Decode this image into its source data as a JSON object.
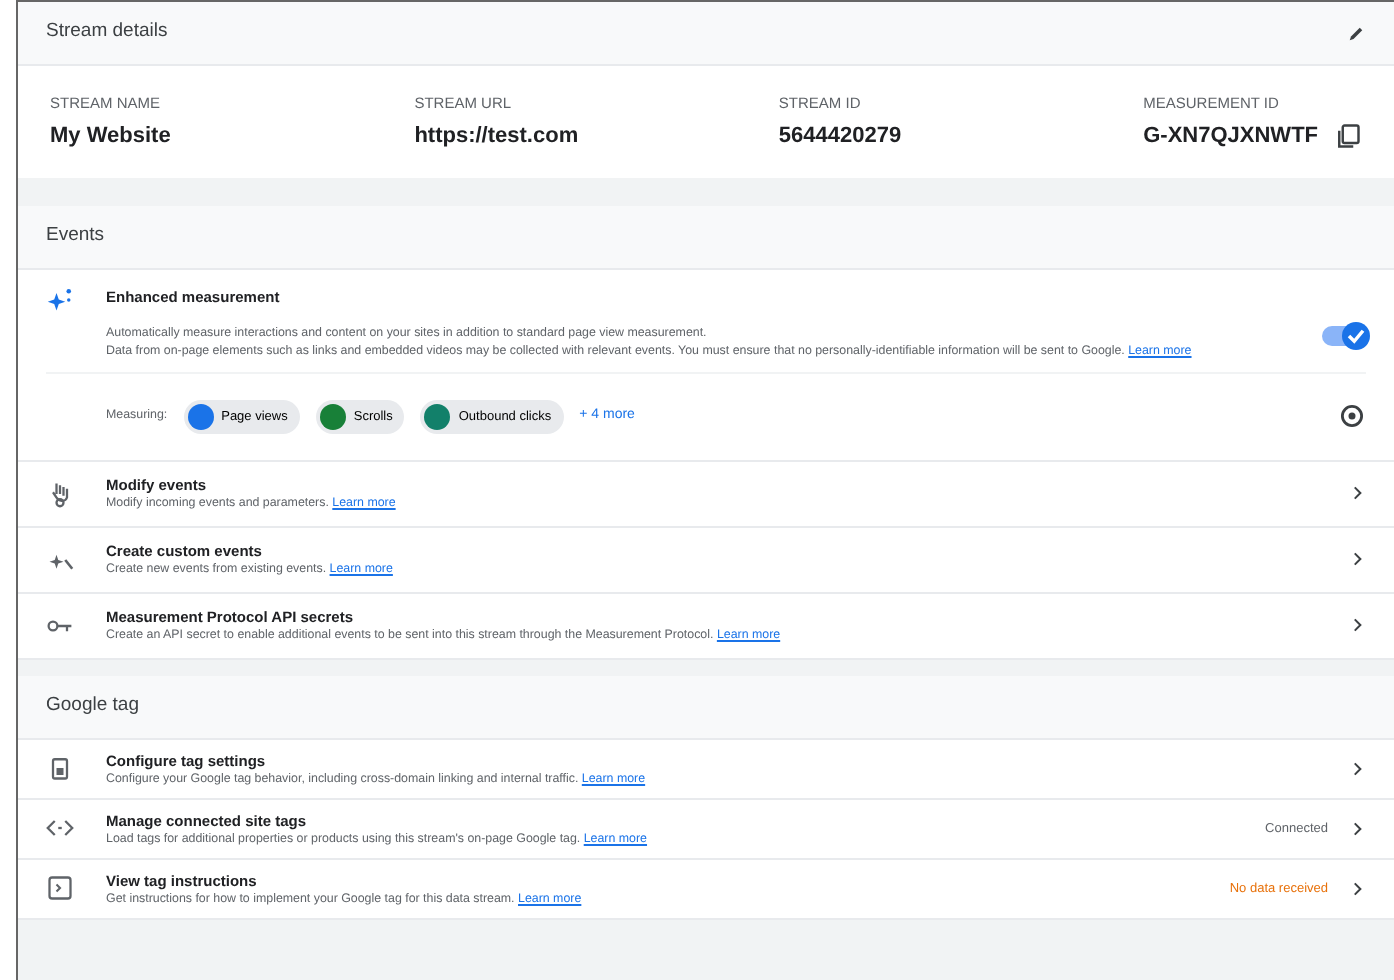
{
  "stream_details": {
    "title": "Stream details",
    "fields": [
      {
        "label": "STREAM NAME",
        "value": "My Website"
      },
      {
        "label": "STREAM URL",
        "value": "https://test.com"
      },
      {
        "label": "STREAM ID",
        "value": "5644420279"
      },
      {
        "label": "MEASUREMENT ID",
        "value": "G-XN7QJXNWTF"
      }
    ]
  },
  "events": {
    "title": "Events",
    "enhanced": {
      "title": "Enhanced measurement",
      "text": "Automatically measure interactions and content on your sites in addition to standard page view measurement.",
      "text2": "Data from on-page elements such as links and embedded videos may be collected with relevant events. You must ensure that no personally-identifiable information will be sent to Google.",
      "link": "Learn more",
      "on": true,
      "measuring_label": "Measuring:",
      "chips": [
        {
          "label": "Page views",
          "color": "#1a73e8"
        },
        {
          "label": "Scrolls",
          "color": "#188038"
        },
        {
          "label": "Outbound clicks",
          "color": "#12806a"
        }
      ],
      "more": "+ 4 more"
    },
    "rows": [
      {
        "title": "Modify events",
        "text": "Modify incoming events and parameters.",
        "link": "Learn more"
      },
      {
        "title": "Create custom events",
        "text": "Create new events from existing events.",
        "link": "Learn more"
      },
      {
        "title": "Measurement Protocol API secrets",
        "text": "Create an API secret to enable additional events to be sent into this stream through the Measurement Protocol.",
        "link": "Learn more"
      }
    ]
  },
  "google_tag": {
    "title": "Google tag",
    "rows": [
      {
        "title": "Configure tag settings",
        "text": "Configure your Google tag behavior, including cross-domain linking and internal traffic.",
        "link": "Learn more"
      },
      {
        "title": "Manage connected site tags",
        "text": "Load tags for additional properties or products using this stream's on-page Google tag.",
        "link": "Learn more",
        "status": "Connected",
        "warning": false
      },
      {
        "title": "View tag instructions",
        "text": "Get instructions for how to implement your Google tag for this data stream.",
        "link": "Learn more",
        "status": "No data received",
        "warning": true
      }
    ]
  }
}
